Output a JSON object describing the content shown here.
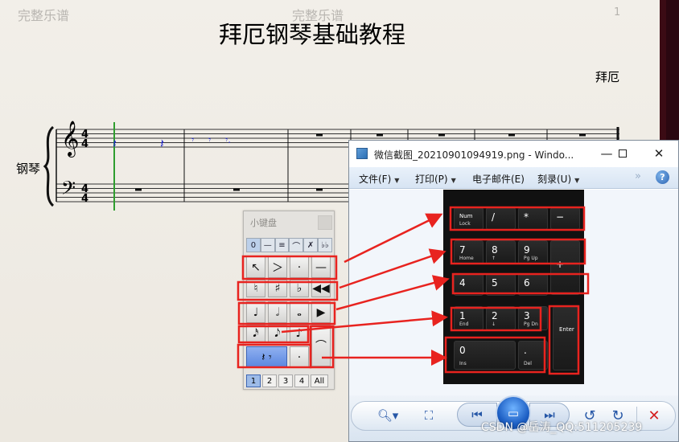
{
  "score": {
    "watermark_left": "完整乐谱",
    "watermark_center": "完整乐谱",
    "page_number": "1",
    "title": "拜厄钢琴基础教程",
    "composer": "拜厄",
    "instrument": "钢琴",
    "time_signature_top": "4",
    "time_signature_bottom": "4"
  },
  "keypad": {
    "title": "小键盘",
    "tabs": [
      "0",
      "—",
      "≡",
      "⌒",
      "✗",
      "♭♭"
    ],
    "rows": [
      [
        "↖",
        "＞",
        "·",
        "—"
      ],
      [
        "♮",
        "♯",
        "♭",
        "◀◀"
      ],
      [
        "♩",
        "𝅗𝅥",
        "𝅝",
        "▶"
      ],
      [
        "𝅘𝅥𝅯",
        "𝅘𝅥𝅮",
        "♪",
        "⌒"
      ],
      [
        "𝄽 𝄾",
        "·"
      ]
    ],
    "pages": [
      "1",
      "2",
      "3",
      "4",
      "All"
    ]
  },
  "viewer": {
    "title": "微信截图_20210901094919.png - Windo...",
    "menu": [
      "文件(F)",
      "打印(P)",
      "电子邮件(E)",
      "刻录(U)"
    ],
    "more": "»",
    "help": "?"
  },
  "numpad": {
    "row1": [
      {
        "main": "Num",
        "sub": "Lock"
      },
      {
        "main": "/",
        "sub": ""
      },
      {
        "main": "*",
        "sub": ""
      },
      {
        "main": "−",
        "sub": ""
      }
    ],
    "row2": [
      {
        "main": "7",
        "sub": "Home"
      },
      {
        "main": "8",
        "sub": "↑"
      },
      {
        "main": "9",
        "sub": "Pg Up"
      },
      {
        "main": "+",
        "sub": ""
      }
    ],
    "row3": [
      {
        "main": "4",
        "sub": ""
      },
      {
        "main": "5",
        "sub": ""
      },
      {
        "main": "6",
        "sub": ""
      }
    ],
    "row4": [
      {
        "main": "1",
        "sub": "End"
      },
      {
        "main": "2",
        "sub": "↓"
      },
      {
        "main": "3",
        "sub": "Pg Dn"
      },
      {
        "main": "Enter",
        "sub": ""
      }
    ],
    "row5": [
      {
        "main": "0",
        "sub": "Ins"
      },
      {
        "main": ".",
        "sub": "Del"
      }
    ]
  },
  "credit": "CSDN @岳涛_QQ:511205239",
  "colors": {
    "accent_red": "#e8231f",
    "rest_blue": "#1f25c9",
    "cursor_green": "#2f9e2f"
  }
}
